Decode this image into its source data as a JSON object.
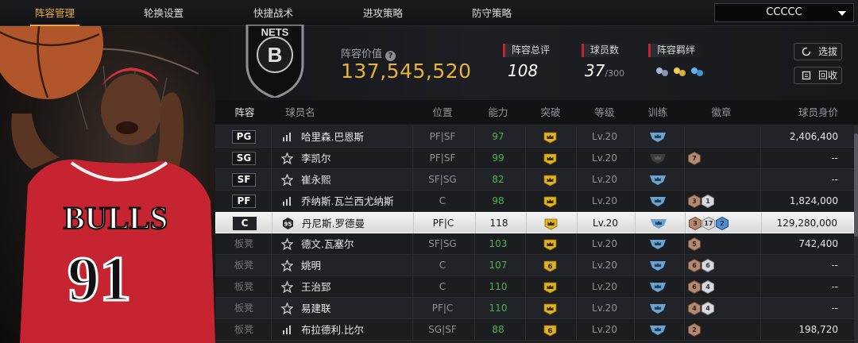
{
  "nav": {
    "tabs": [
      {
        "label": "阵容管理",
        "active": true
      },
      {
        "label": "轮换设置",
        "active": false
      },
      {
        "label": "快捷战术",
        "active": false
      },
      {
        "label": "进攻策略",
        "active": false
      },
      {
        "label": "防守策略",
        "active": false
      }
    ],
    "account_select": "CCCCC"
  },
  "header": {
    "team_logo_text": "NETS",
    "lineup_value_label": "阵容价值",
    "lineup_value": "137,545,520",
    "overall_label": "阵容总评",
    "overall_value": "108",
    "players_label": "球员数",
    "players_value": "37",
    "players_max": "/300",
    "bond_label": "阵容羁绊",
    "draft_button": "选拔",
    "recycle_button": "回收"
  },
  "colors": {
    "accent": "#e9a92f",
    "ability_green": "#49b149",
    "value_gold": "#e9b23c",
    "stat_red": "#c0262b"
  },
  "table": {
    "headers": [
      "阵容",
      "球员名",
      "位置",
      "能力",
      "突破",
      "等级",
      "训练",
      "徽章",
      "球员身价"
    ],
    "rows": [
      {
        "slot": "PG",
        "starter": true,
        "type_icon": "bars-icon",
        "name": "哈里森.巴恩斯",
        "position": "PF|SF",
        "ability": "97",
        "breakthrough": "crown",
        "level": "Lv.20",
        "training": "blue",
        "badges": [],
        "salary": "2,406,400",
        "selected": false
      },
      {
        "slot": "SG",
        "starter": true,
        "type_icon": "star-icon",
        "name": "李凯尔",
        "position": "PF|SF",
        "ability": "99",
        "breakthrough": "crown",
        "level": "Lv.20",
        "training": "dark",
        "badges": [
          {
            "t": "7",
            "c": "bronze"
          }
        ],
        "salary": "--",
        "selected": false
      },
      {
        "slot": "SF",
        "starter": true,
        "type_icon": "star-icon",
        "name": "崔永熙",
        "position": "SF|SG",
        "ability": "82",
        "breakthrough": "crown",
        "level": "Lv.20",
        "training": "blue",
        "badges": [],
        "salary": "--",
        "selected": false
      },
      {
        "slot": "PF",
        "starter": true,
        "type_icon": "bars-icon",
        "name": "乔纳斯.瓦兰西尤纳斯",
        "position": "C",
        "ability": "98",
        "breakthrough": "crown",
        "level": "Lv.20",
        "training": "blue",
        "badges": [
          {
            "t": "3",
            "c": "bronze"
          },
          {
            "t": "1",
            "c": "silver"
          }
        ],
        "salary": "1,824,000",
        "selected": false
      },
      {
        "slot": "C",
        "starter": true,
        "type_icon": "hex-95-icon",
        "name": "丹尼斯.罗德曼",
        "position": "PF|C",
        "ability": "118",
        "breakthrough": "crown",
        "level": "Lv.20",
        "training": "blue",
        "badges": [
          {
            "t": "3",
            "c": "bronze"
          },
          {
            "t": "17",
            "c": "silver"
          },
          {
            "t": "2",
            "c": "blue"
          }
        ],
        "salary": "129,280,000",
        "selected": true
      },
      {
        "slot": "板凳",
        "starter": false,
        "type_icon": "star-icon",
        "name": "德文.瓦塞尔",
        "position": "SF|SG",
        "ability": "103",
        "breakthrough": "crown",
        "level": "Lv.20",
        "training": "blue",
        "badges": [
          {
            "t": "5",
            "c": "bronze"
          }
        ],
        "salary": "742,400",
        "selected": false
      },
      {
        "slot": "板凳",
        "starter": false,
        "type_icon": "star-icon",
        "name": "姚明",
        "position": "C",
        "ability": "107",
        "breakthrough": "6",
        "level": "Lv.20",
        "training": "blue",
        "badges": [
          {
            "t": "6",
            "c": "bronze"
          },
          {
            "t": "6",
            "c": "silver"
          }
        ],
        "salary": "--",
        "selected": false
      },
      {
        "slot": "板凳",
        "starter": false,
        "type_icon": "star-icon",
        "name": "王治郅",
        "position": "C",
        "ability": "110",
        "breakthrough": "crown",
        "level": "Lv.20",
        "training": "blue",
        "badges": [
          {
            "t": "6",
            "c": "bronze"
          },
          {
            "t": "4",
            "c": "silver"
          }
        ],
        "salary": "--",
        "selected": false
      },
      {
        "slot": "板凳",
        "starter": false,
        "type_icon": "star-icon",
        "name": "易建联",
        "position": "PF|C",
        "ability": "110",
        "breakthrough": "crown",
        "level": "Lv.20",
        "training": "blue",
        "badges": [
          {
            "t": "4",
            "c": "bronze"
          },
          {
            "t": "4",
            "c": "silver"
          }
        ],
        "salary": "--",
        "selected": false
      },
      {
        "slot": "板凳",
        "starter": false,
        "type_icon": "bars-icon",
        "name": "布拉德利.比尔",
        "position": "SG|SF",
        "ability": "88",
        "breakthrough": "6",
        "level": "Lv.20",
        "training": "blue",
        "badges": [
          {
            "t": "2",
            "c": "bronze"
          }
        ],
        "salary": "198,720",
        "selected": false
      }
    ]
  },
  "player_art": {
    "jersey_team": "BULLS",
    "jersey_number": "91"
  }
}
